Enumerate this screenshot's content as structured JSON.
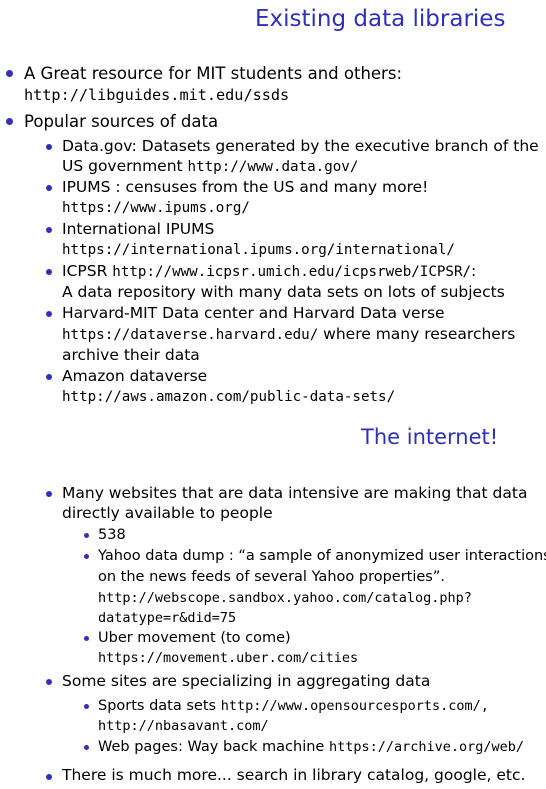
{
  "slide1": {
    "title": "Existing data libraries",
    "item1_text": "A Great resource for MIT students and others:",
    "item1_url": "http://libguides.mit.edu/ssds",
    "item2_text": "Popular sources of data",
    "sources": {
      "datagov_text": "Data.gov: Datasets generated by the executive branch of the",
      "datagov_text2": "US government ",
      "datagov_url": "http://www.data.gov/",
      "ipums_text": "IPUMS : censuses from the US and many more!",
      "ipums_url": "https://www.ipums.org/",
      "intl_text": "International IPUMS",
      "intl_url": "https://international.ipums.org/international/",
      "icpsr_text": "ICPSR ",
      "icpsr_url": "http://www.icpsr.umich.edu/icpsrweb/ICPSR/",
      "icpsr_colon": ":",
      "icpsr_text2": "A data repository with many data sets on lots of subjects",
      "harvard_text": "Harvard-MIT Data center and Harvard Data verse",
      "harvard_url": "https://dataverse.harvard.edu/",
      "harvard_text2": " where many researchers",
      "harvard_text3": "archive their data",
      "amazon_text": "Amazon dataverse",
      "amazon_url": "http://aws.amazon.com/public-data-sets/"
    }
  },
  "slide2": {
    "title": "The internet!",
    "item1_text": "Many websites that are data intensive are making that data",
    "item1_text2": "directly available to people",
    "sub538": "538",
    "yahoo_text": "Yahoo data dump :  “a sample of anonymized user interactions",
    "yahoo_text2": "on the news feeds of several Yahoo properties”.",
    "yahoo_url1": "http://webscope.sandbox.yahoo.com/catalog.php?",
    "yahoo_url2": "datatype=r&did=75",
    "uber_text": "Uber movement (to come)",
    "uber_url": "https://movement.uber.com/cities",
    "item2_text": "Some sites are specializing in aggregating data",
    "sports_text": "Sports data sets ",
    "sports_url1": "http://www.opensourcesports.com/,",
    "sports_url2": "http://nbasavant.com/",
    "web_text": "Web pages: Way back machine ",
    "web_url": "https://archive.org/web/",
    "item3_text": "There is much more... search in library catalog, google, etc."
  },
  "colors": {
    "accent": "#2f2fbf",
    "text": "#000000",
    "background": "#ffffff"
  }
}
